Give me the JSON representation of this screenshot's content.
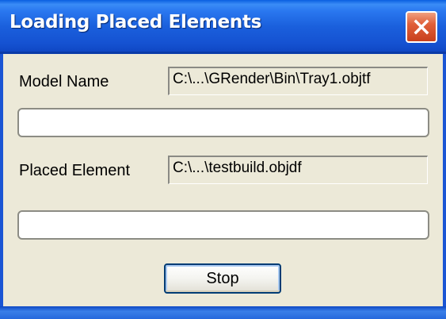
{
  "window": {
    "title": "Loading Placed Elements",
    "close_icon": "close-icon"
  },
  "model": {
    "label": "Model Name",
    "path": "C:\\...\\GRender\\Bin\\Tray1.objtf",
    "progress": 0
  },
  "element": {
    "label": "Placed Element",
    "path": "C:\\...\\testbuild.objdf",
    "progress": 0
  },
  "actions": {
    "stop_label": "Stop"
  },
  "colors": {
    "titlebar": "#2a78f0",
    "close_button": "#e0603a",
    "dialog_background": "#ece9d8"
  }
}
